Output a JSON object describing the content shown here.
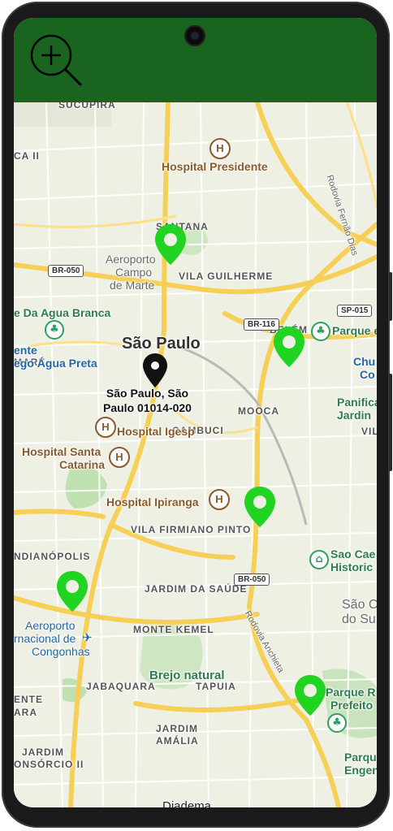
{
  "app": {
    "zoom_button_icon": "zoom-in-magnifier-icon",
    "appbar_color": "#19641f"
  },
  "map": {
    "districts": {
      "sucupira": "SUCUPIRA",
      "ca_ii": "CA II",
      "santana": "SANTANA",
      "vila_guilherme": "VILA GUILHERME",
      "belem": "BELÉM",
      "mooca": "MOOCA",
      "cambuci": "CAMBUCI",
      "vila_firmiano_pinto": "VILA FIRMIANO PINTO",
      "jardim_da_saude": "JARDIM DA SAÚDE",
      "monte_kemel": "MONTE KEMEL",
      "jabaquara": "JABAQUARA",
      "tapuia": "TAPUIA",
      "jardim_amalia_1": "JARDIM",
      "jardim_amalia_2": "AMÁLIA",
      "jardim_consorcio_1": "JARDIM",
      "jardim_consorcio_2": "ONSÓRCIO II",
      "indianopolis": "NDIANÓPOLIS",
      "mare": "MARÉ",
      "vil": "VIL",
      "ente": "ENTE",
      "ara": "ARA"
    },
    "pois": {
      "hospital_presidente": "Hospital Presidente",
      "aeroporto_campo_1": "Aeroporto",
      "aeroporto_campo_2": "Campo",
      "aeroporto_campo_3": "de Marte",
      "agua_branca": "e Da Agua Branca",
      "agua_preta_1": "ente",
      "agua_preta_2": "ego Água Preta",
      "hospital_igesp": "Hospital Igesp",
      "hospital_santa_catarina_1": "Hospital Santa",
      "hospital_santa_catarina_2": "Catarina",
      "hospital_ipiranga": "Hospital Ipiranga",
      "parque_right": "Parque e",
      "chu_1": "Chu",
      "chu_2": "Co",
      "panifica_1": "Panifica",
      "panifica_2": "Jardin",
      "sao_cae_1": "Sao Cae",
      "sao_cae_2": "Historic",
      "sao_c_1": "São C",
      "sao_c_2": "do Su",
      "aeroporto_congonhas_1": "Aeroporto",
      "aeroporto_congonhas_2": "rnacional de",
      "aeroporto_congonhas_3": "Congonhas",
      "brejo_natural": "Brejo natural",
      "parque_prefeito_1": "Parque R",
      "parque_prefeito_2": "Prefeito",
      "parque_eng_1": "Parque",
      "parque_eng_2": "Engen",
      "diadema": "Diadema",
      "rodovia_fernao": "Rodovia Fernão Dias",
      "rodovia_anchieta": "Rodovia Anchieta"
    },
    "roads": {
      "br050_top": "BR-050",
      "br116": "BR-116",
      "sp015": "SP-015",
      "br050_bottom": "BR-050"
    },
    "city_label": "São Paulo",
    "selected_pin": {
      "address_line1": "São Paulo, São",
      "address_line2": "Paulo 01014-020"
    },
    "pin_color": "#22d422"
  }
}
